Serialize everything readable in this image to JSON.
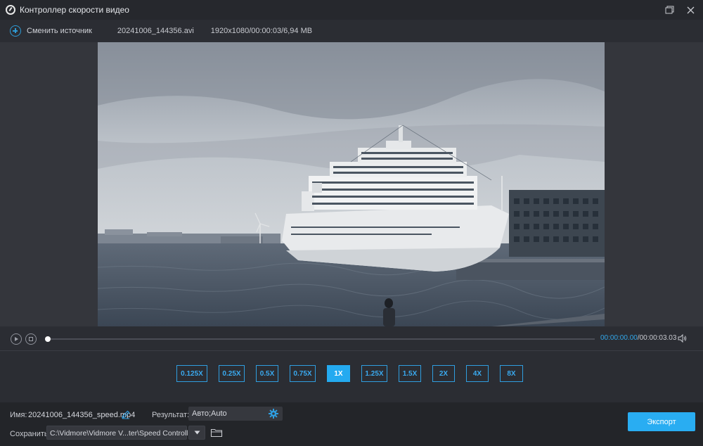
{
  "window": {
    "title": "Контроллер скорости видео"
  },
  "toolbar": {
    "change_source_label": "Сменить источник",
    "file_name": "20241006_144356.avi",
    "file_meta": "1920x1080/00:00:03/6,94 MB"
  },
  "player": {
    "time_current": "00:00:00.00",
    "time_total": "/00:00:03.03",
    "progress": 0
  },
  "speeds": {
    "options": [
      "0.125X",
      "0.25X",
      "0.5X",
      "0.75X",
      "1X",
      "1.25X",
      "1.5X",
      "2X",
      "4X",
      "8X"
    ],
    "selected": "1X"
  },
  "output": {
    "name_label": "Имя:",
    "name_value": "20241006_144356_speed.mp4",
    "result_label": "Результат:",
    "result_value": "Авто;Auto",
    "save_label": "Сохранить:",
    "save_path": "C:\\Vidmore\\Vidmore V...ter\\Speed Controller",
    "export_label": "Экспорт"
  },
  "colors": {
    "accent": "#29adf2",
    "background": "#2b2d33",
    "panel": "#232529"
  }
}
